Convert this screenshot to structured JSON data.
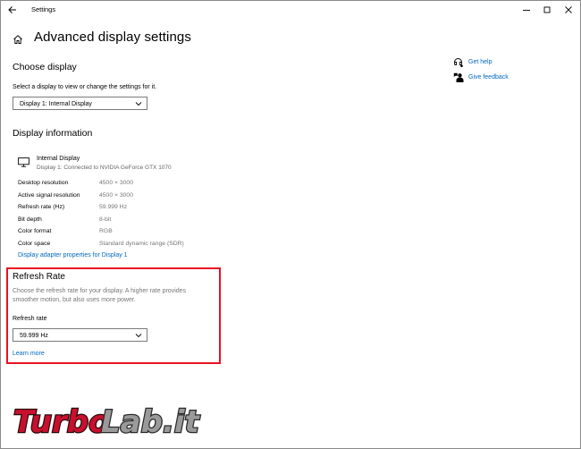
{
  "window": {
    "title": "Settings",
    "controls": [
      "minimize-icon",
      "maximize-icon",
      "close-icon"
    ]
  },
  "header": {
    "title": "Advanced display settings"
  },
  "choose_display": {
    "heading": "Choose display",
    "description": "Select a display to view or change the settings for it.",
    "selected": "Display 1: Internal Display"
  },
  "display_info": {
    "heading": "Display information",
    "display_name": "Internal Display",
    "display_sub": "Display 1: Connected to NVIDIA GeForce GTX 1070",
    "rows": [
      {
        "label": "Desktop resolution",
        "value": "4500 × 3000"
      },
      {
        "label": "Active signal resolution",
        "value": "4500 × 3000"
      },
      {
        "label": "Refresh rate (Hz)",
        "value": "59.999 Hz"
      },
      {
        "label": "Bit depth",
        "value": "8-bit"
      },
      {
        "label": "Color format",
        "value": "RGB"
      },
      {
        "label": "Color space",
        "value": "Standard dynamic range (SDR)"
      }
    ],
    "adapter_link": "Display adapter properties for Display 1"
  },
  "refresh_rate": {
    "heading": "Refresh Rate",
    "description_line1": "Choose the refresh rate for your display. A higher rate provides",
    "description_line2": "smoother motion, but also uses more power.",
    "field_label": "Refresh rate",
    "selected": "59.999 Hz",
    "learn_more": "Learn more"
  },
  "side": {
    "get_help": "Get help",
    "give_feedback": "Give feedback"
  },
  "watermark": {
    "text": "TurboLab.it"
  },
  "colors": {
    "accent": "#0067c0",
    "highlight": "#e81123",
    "muted": "#767676"
  }
}
